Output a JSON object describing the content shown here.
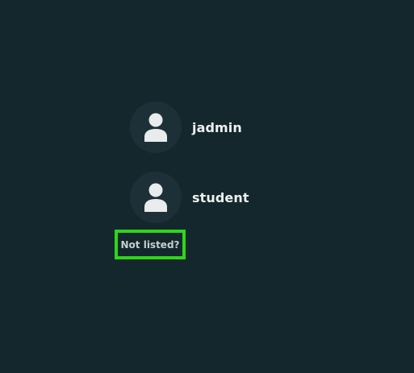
{
  "users": [
    {
      "name": "jadmin",
      "avatar_icon": "user-silhouette-icon"
    },
    {
      "name": "student",
      "avatar_icon": "user-silhouette-icon"
    }
  ],
  "not_listed": {
    "label": "Not listed?"
  },
  "colors": {
    "background": "#14272d",
    "avatar_bg": "#1d3038",
    "avatar_icon": "#e9ecec",
    "username_text": "#eef1f1",
    "not_listed_text": "#c7cfd0",
    "highlight_border": "#2ed61a"
  }
}
